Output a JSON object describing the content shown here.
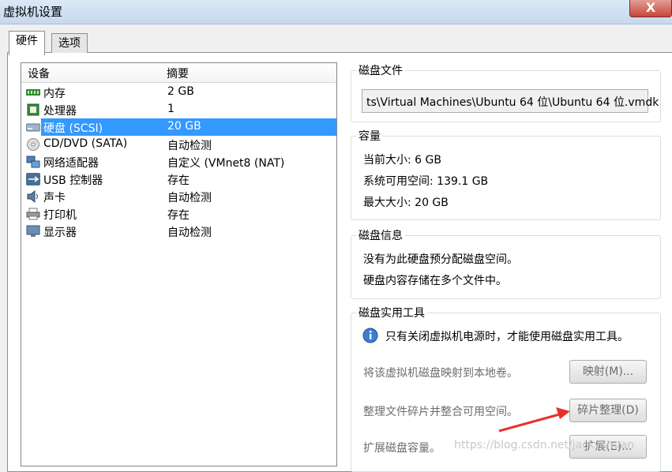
{
  "window": {
    "title": "虚拟机设置",
    "close_label": "X"
  },
  "tabs": [
    {
      "label": "硬件",
      "active": true
    },
    {
      "label": "选项",
      "active": false
    }
  ],
  "devices": {
    "columns": [
      "设备",
      "摘要"
    ],
    "rows": [
      {
        "name": "内存",
        "summary": "2 GB",
        "icon": "memory-icon"
      },
      {
        "name": "处理器",
        "summary": "1",
        "icon": "processor-icon"
      },
      {
        "name": "硬盘 (SCSI)",
        "summary": "20 GB",
        "icon": "hard-disk-icon",
        "selected": true
      },
      {
        "name": "CD/DVD (SATA)",
        "summary": "自动检测",
        "icon": "cd-dvd-icon"
      },
      {
        "name": "网络适配器",
        "summary": "自定义 (VMnet8 (NAT)",
        "icon": "network-adapter-icon"
      },
      {
        "name": "USB 控制器",
        "summary": "存在",
        "icon": "usb-icon"
      },
      {
        "name": "声卡",
        "summary": "自动检测",
        "icon": "sound-card-icon"
      },
      {
        "name": "打印机",
        "summary": "存在",
        "icon": "printer-icon"
      },
      {
        "name": "显示器",
        "summary": "自动检测",
        "icon": "display-icon"
      }
    ]
  },
  "disk_file": {
    "title": "磁盘文件",
    "path": "ts\\Virtual Machines\\Ubuntu 64 位\\Ubuntu 64 位.vmdk"
  },
  "capacity": {
    "title": "容量",
    "current_size": "当前大小: 6 GB",
    "system_free": "系统可用空间: 139.1 GB",
    "max_size": "最大大小: 20 GB"
  },
  "disk_info": {
    "title": "磁盘信息",
    "line1": "没有为此硬盘预分配磁盘空间。",
    "line2": "硬盘内容存储在多个文件中。"
  },
  "disk_utilities": {
    "title": "磁盘实用工具",
    "notice": "只有关闭虚拟机电源时，才能使用磁盘实用工具。",
    "map_desc": "将该虚拟机磁盘映射到本地卷。",
    "map_button": "映射(M)...",
    "defrag_desc": "整理文件碎片并整合可用空间。",
    "defrag_button": "碎片整理(D)",
    "expand_desc": "扩展磁盘容量。",
    "expand_button": "扩展(E)..."
  },
  "watermark": "https://blog.csdn.net/jackyshuan",
  "colors": {
    "selection": "#3399ff",
    "annotation_arrow": "#e8302a"
  }
}
